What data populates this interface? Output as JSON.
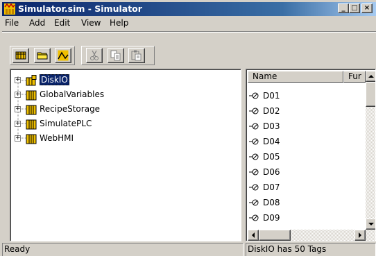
{
  "window": {
    "title": "Simulator.sim - Simulator",
    "controls": {
      "minimize": "_",
      "maximize": "□",
      "close": "×"
    }
  },
  "menu": {
    "items": [
      "File",
      "Add",
      "Edit",
      "View",
      "Help"
    ]
  },
  "toolbar": {
    "buttons": [
      "new-tag-icon",
      "open-folder-icon",
      "trend-icon",
      "cut-icon",
      "copy-icon",
      "paste-icon"
    ]
  },
  "tree": {
    "nodes": [
      {
        "label": "DiskIO",
        "selected": true,
        "expander": "+"
      },
      {
        "label": "GlobalVariables",
        "selected": false,
        "expander": "+"
      },
      {
        "label": "RecipeStorage",
        "selected": false,
        "expander": "+"
      },
      {
        "label": "SimulatePLC",
        "selected": false,
        "expander": "+"
      },
      {
        "label": "WebHMI",
        "selected": false,
        "expander": "+"
      }
    ]
  },
  "list": {
    "columns": [
      "Name",
      "Fur"
    ],
    "rows": [
      "D01",
      "D02",
      "D03",
      "D04",
      "D05",
      "D06",
      "D07",
      "D08",
      "D09"
    ]
  },
  "status": {
    "left": "Ready",
    "right": "DiskIO has 50 Tags"
  },
  "colors": {
    "title_bar_start": "#0a246a",
    "title_bar_end": "#a6caf0",
    "window_face": "#d4d0c8",
    "selection": "#0a246a",
    "folder_yellow": "#e8c000"
  }
}
